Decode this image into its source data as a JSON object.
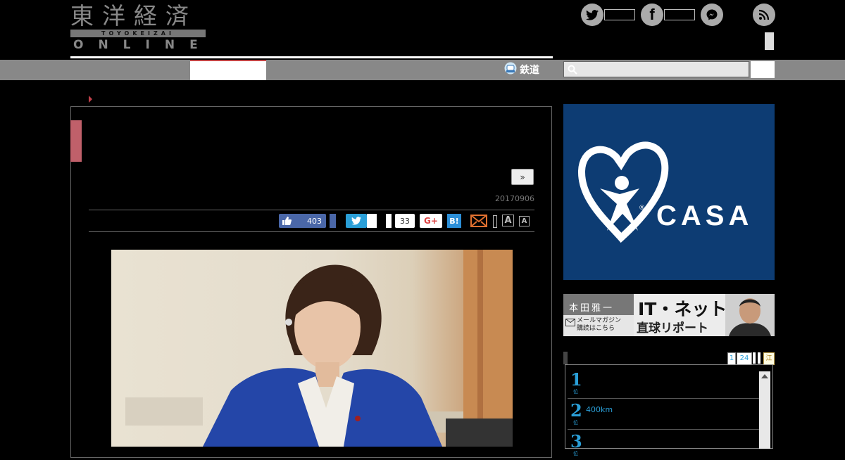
{
  "brand": {
    "logo_kanji": "東洋経済",
    "logo_romaji": "TOYOKEIZAI",
    "logo_online": "ONLINE"
  },
  "social": {
    "icons": [
      "twitter-icon",
      "facebook-icon",
      "messenger-icon",
      "rss-icon"
    ]
  },
  "nav": {
    "tetsudo_label": "鉄道"
  },
  "article": {
    "next_label": "»",
    "date": "20170906",
    "share": {
      "like_count": "403",
      "facebook_share_count": "33",
      "gplus_label": "G+",
      "hatena_label": "B!",
      "font_large_label": "A",
      "font_small_label": "A"
    }
  },
  "sidebar": {
    "ad_brand": "CASA",
    "banner": {
      "author": "本田雅一",
      "mail_line1": "メールマガジン",
      "mail_line2": "購読はこちら",
      "title_line1": "IT・ネット",
      "title_line2": "直球リポート"
    },
    "ranking": {
      "tabs": [
        "1",
        "24",
        "",
        "",
        "江"
      ],
      "rows": [
        {
          "rank": "1",
          "sub": "位",
          "text": ""
        },
        {
          "rank": "2",
          "sub": "位",
          "text": "400km"
        },
        {
          "rank": "3",
          "sub": "位",
          "text": ""
        }
      ]
    }
  },
  "colors": {
    "accent_red": "#c0606a",
    "nav_gray": "#888888",
    "twitter_blue": "#2a9fd8",
    "facebook_blue": "#4a67a8",
    "casa_navy": "#0d3c73"
  }
}
